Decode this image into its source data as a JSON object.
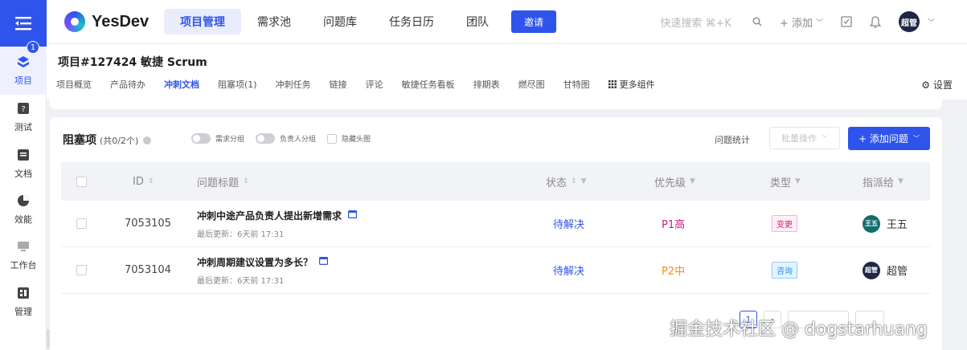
{
  "rail": {
    "items": [
      {
        "label": "项目",
        "icon": "project-icon",
        "badge": "1"
      },
      {
        "label": "测试",
        "icon": "test-icon"
      },
      {
        "label": "文档",
        "icon": "doc-icon"
      },
      {
        "label": "效能",
        "icon": "pie-chart-icon"
      },
      {
        "label": "工作台",
        "icon": "desktop-icon"
      },
      {
        "label": "管理",
        "icon": "grid-icon"
      }
    ]
  },
  "topbar": {
    "logo": "YesDev",
    "nav": [
      "项目管理",
      "需求池",
      "问题库",
      "任务日历",
      "团队"
    ],
    "invite": "邀请",
    "quick_search": "快速搜索 ⌘+K",
    "add": "+ 添加",
    "avatar": "超管"
  },
  "project": {
    "title": "项目#127424 敏捷 Scrum",
    "tabs": [
      "项目概览",
      "产品待办",
      "冲刺文档",
      "阻塞项(1)",
      "冲刺任务",
      "链接",
      "评论",
      "敏捷任务看板",
      "排期表",
      "燃尽图",
      "甘特图"
    ],
    "more": "更多组件",
    "settings": "设置"
  },
  "blockers": {
    "title": "阻塞项",
    "count": "(共0/2个)",
    "toggles": [
      "需求分组",
      "负责人分组"
    ],
    "hide_header": "隐藏头图",
    "stats": "问题统计",
    "batch": "批量操作",
    "add_issue": "+ 添加问题",
    "columns": [
      "ID",
      "问题标题",
      "状态",
      "优先级",
      "类型",
      "指派给"
    ],
    "rows": [
      {
        "id": "7053105",
        "title": "冲刺中途产品负责人提出新增需求",
        "meta": "最后更新：6天前 17:31",
        "status": "待解决",
        "priority": "P1高",
        "type": "变更",
        "assignee_avatar": "王五",
        "assignee": "王五"
      },
      {
        "id": "7053104",
        "title": "冲刺周期建议设置为多长？",
        "meta": "最后更新：6天前 17:31",
        "status": "待解决",
        "priority": "P2中",
        "type": "咨询",
        "assignee_avatar": "超管",
        "assignee": "超管"
      }
    ],
    "pager": {
      "page": "1"
    }
  },
  "watermark": "掘金技术社区 @ dogstarhuang",
  "colors": {
    "accent": "#2f54eb",
    "p1": "#c41d7f",
    "p2": "#fa8c16",
    "tag_change": "#c41d7f",
    "tag_ask": "#1890ff"
  }
}
